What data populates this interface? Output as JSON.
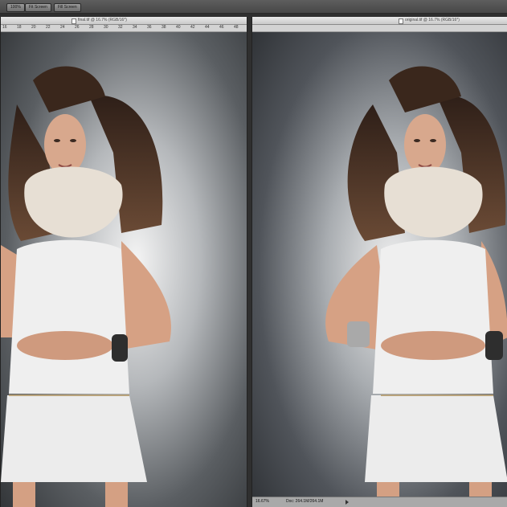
{
  "toolbar": {
    "buttons": [
      "100%",
      "Fit Screen",
      "Fill Screen"
    ]
  },
  "documents": [
    {
      "title": "final.tif @ 16.7% (RGB/16*)",
      "ruler": [
        "16",
        "18",
        "20",
        "22",
        "24",
        "26",
        "28",
        "30",
        "32",
        "34",
        "36",
        "38",
        "40",
        "42",
        "44",
        "46",
        "48"
      ],
      "zoom": "",
      "doc_info": ""
    },
    {
      "title": "original.tif @ 16.7% (RGB/16*)",
      "ruler": [],
      "zoom": "16.67%",
      "doc_info": "Doc: 264.1M/264.1M"
    }
  ],
  "icons": {
    "document": "doc-icon",
    "status_menu": "triangle-right-icon"
  },
  "colors": {
    "backdrop_center": "#f2f2f2",
    "backdrop_edge": "#3e4246",
    "hair": "#4a3426",
    "fur": "#e6ded3",
    "dress": "#eeeeee",
    "skin": "#d9a78a"
  }
}
